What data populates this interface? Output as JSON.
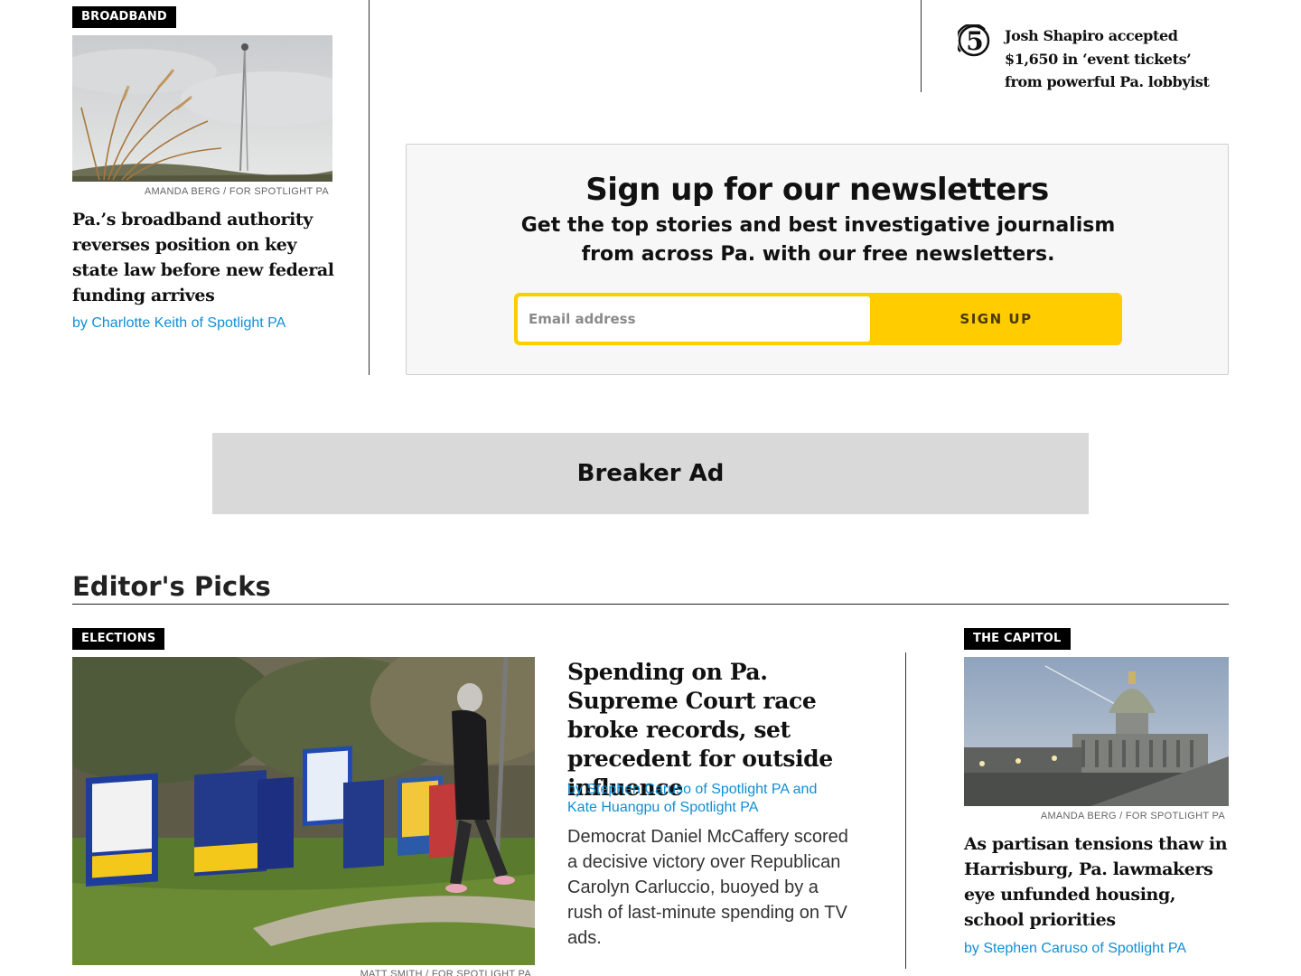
{
  "top_left_story": {
    "tag": "BROADBAND",
    "photo_credit": "AMANDA BERG / FOR SPOTLIGHT PA",
    "headline": "Pa.’s broadband authority reverses position on key state law before new federal funding arrives",
    "byline": "by Charlotte Keith of Spotlight PA"
  },
  "most_read": {
    "number": "5",
    "headline": "Josh Shapiro accepted $1,650 in ‘event tickets’ from powerful Pa. lobbyist"
  },
  "newsletter": {
    "title": "Sign up for our newsletters",
    "subtitle": "Get the top stories and best investigative journalism from across Pa. with our free newsletters.",
    "email_placeholder": "Email address",
    "button_label": "SIGN UP"
  },
  "breaker_ad": {
    "label": "Breaker Ad"
  },
  "editors_picks": {
    "title": "Editor's Picks",
    "feature": {
      "tag": "ELECTIONS",
      "photo_credit": "MATT SMITH / FOR SPOTLIGHT PA",
      "headline": "Spending on Pa. Supreme Court race broke records, set precedent for outside influence",
      "byline": "by Stephen Caruso of Spotlight PA and Kate Huangpu of Spotlight PA",
      "summary": "Democrat Daniel McCaffery scored a decisive victory over Republican Carolyn Carluccio, buoyed by a rush of last-minute spending on TV ads."
    },
    "side": {
      "tag": "THE CAPITOL",
      "photo_credit": "AMANDA BERG / FOR SPOTLIGHT PA",
      "headline": "As partisan tensions thaw in Harrisburg, Pa. lawmakers eye unfunded housing, school priorities",
      "byline": "by Stephen Caruso of Spotlight PA"
    }
  },
  "colors": {
    "accent_yellow": "#ffcc00",
    "byline_blue": "#0f8fd6",
    "tag_bg": "#000000"
  }
}
